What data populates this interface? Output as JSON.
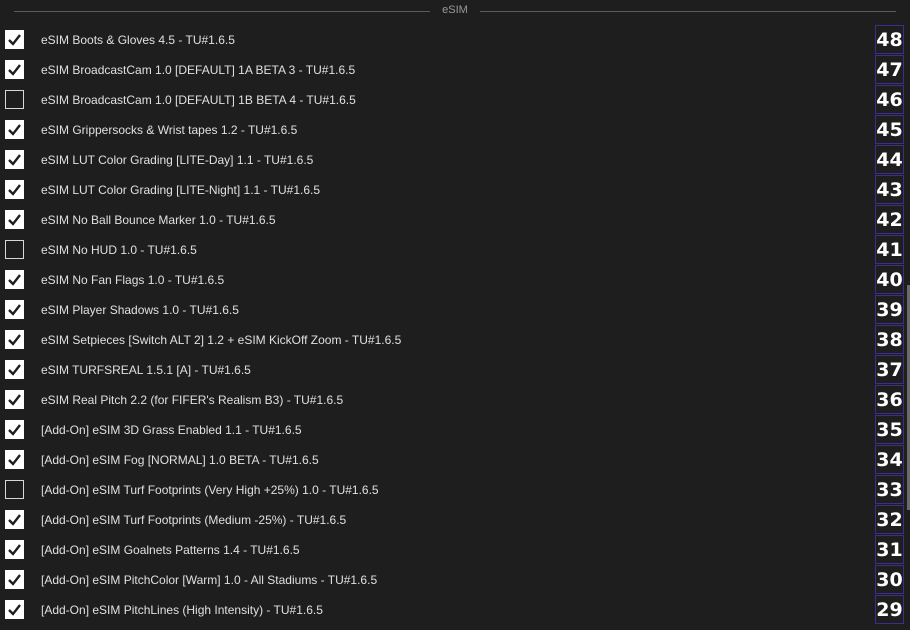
{
  "group": {
    "title": "eSIM"
  },
  "mods": [
    {
      "label": "eSIM Boots & Gloves 4.5 - TU#1.6.5",
      "checked": true,
      "priority": "48"
    },
    {
      "label": "eSIM BroadcastCam 1.0 [DEFAULT] 1A BETA 3 - TU#1.6.5",
      "checked": true,
      "priority": "47"
    },
    {
      "label": "eSIM BroadcastCam 1.0 [DEFAULT] 1B BETA 4 - TU#1.6.5",
      "checked": false,
      "priority": "46"
    },
    {
      "label": "eSIM Grippersocks & Wrist tapes 1.2 - TU#1.6.5",
      "checked": true,
      "priority": "45"
    },
    {
      "label": "eSIM LUT Color Grading [LITE-Day] 1.1 - TU#1.6.5",
      "checked": true,
      "priority": "44"
    },
    {
      "label": "eSIM LUT Color Grading [LITE-Night] 1.1 - TU#1.6.5",
      "checked": true,
      "priority": "43"
    },
    {
      "label": "eSIM No Ball Bounce Marker 1.0 - TU#1.6.5",
      "checked": true,
      "priority": "42"
    },
    {
      "label": "eSIM No HUD 1.0 - TU#1.6.5",
      "checked": false,
      "priority": "41"
    },
    {
      "label": "eSIM No Fan Flags 1.0 - TU#1.6.5",
      "checked": true,
      "priority": "40"
    },
    {
      "label": "eSIM Player Shadows 1.0 - TU#1.6.5",
      "checked": true,
      "priority": "39"
    },
    {
      "label": "eSIM Setpieces [Switch ALT 2] 1.2 + eSIM KickOff Zoom - TU#1.6.5",
      "checked": true,
      "priority": "38"
    },
    {
      "label": "eSIM TURFSREAL 1.5.1 [A] - TU#1.6.5",
      "checked": true,
      "priority": "37"
    },
    {
      "label": "eSIM Real Pitch 2.2 (for FIFER's Realism B3) - TU#1.6.5",
      "checked": true,
      "priority": "36"
    },
    {
      "label": "[Add-On] eSIM 3D Grass Enabled 1.1 - TU#1.6.5",
      "checked": true,
      "priority": "35"
    },
    {
      "label": "[Add-On] eSIM Fog [NORMAL] 1.0 BETA - TU#1.6.5",
      "checked": true,
      "priority": "34"
    },
    {
      "label": "[Add-On] eSIM Turf Footprints (Very High +25%) 1.0 - TU#1.6.5",
      "checked": false,
      "priority": "33"
    },
    {
      "label": "[Add-On] eSIM Turf Footprints (Medium -25%) - TU#1.6.5",
      "checked": true,
      "priority": "32"
    },
    {
      "label": "[Add-On] eSIM Goalnets Patterns 1.4 - TU#1.6.5",
      "checked": true,
      "priority": "31"
    },
    {
      "label": "[Add-On] eSIM PitchColor [Warm] 1.0 - All Stadiums - TU#1.6.5",
      "checked": true,
      "priority": "30"
    },
    {
      "label": "[Add-On] eSIM PitchLines (High Intensity) - TU#1.6.5",
      "checked": true,
      "priority": "29"
    }
  ]
}
